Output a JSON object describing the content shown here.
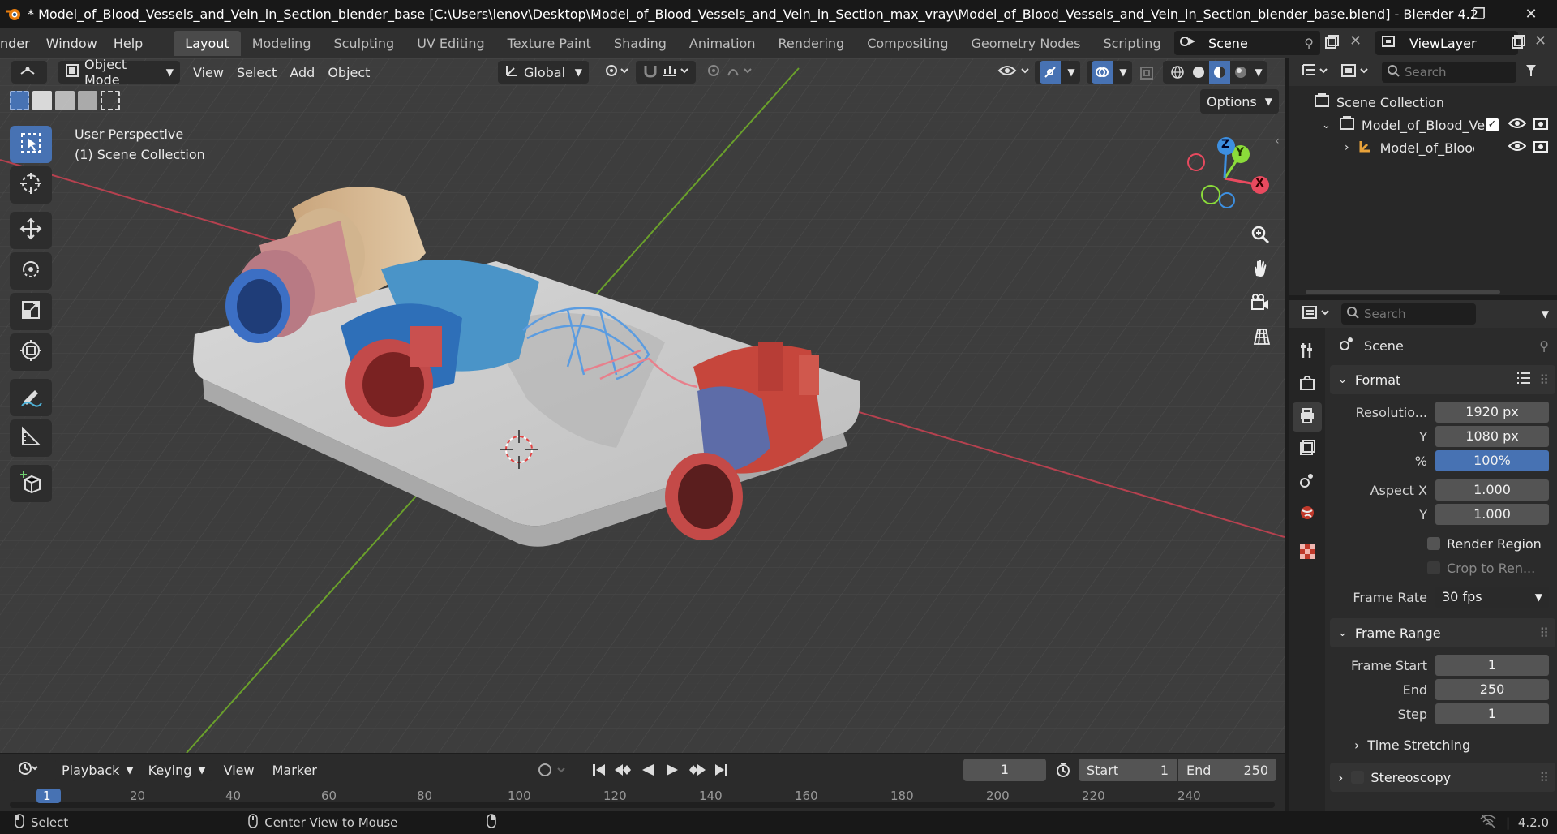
{
  "window": {
    "title": "* Model_of_Blood_Vessels_and_Vein_in_Section_blender_base [C:\\Users\\lenov\\Desktop\\Model_of_Blood_Vessels_and_Vein_in_Section_max_vray\\Model_of_Blood_Vessels_and_Vein_in_Section_blender_base.blend] - Blender 4.2",
    "minimize": "—",
    "restore": "❐",
    "close": "✕"
  },
  "menu": {
    "items": [
      "nder",
      "Window",
      "Help"
    ],
    "workspaces": [
      "Layout",
      "Modeling",
      "Sculpting",
      "UV Editing",
      "Texture Paint",
      "Shading",
      "Animation",
      "Rendering",
      "Compositing",
      "Geometry Nodes",
      "Scripting"
    ],
    "add_workspace": "+",
    "scene": "Scene",
    "view_layer": "ViewLayer"
  },
  "viewport": {
    "mode": "Object Mode",
    "menus": [
      "View",
      "Select",
      "Add",
      "Object"
    ],
    "transform_orientation": "Global",
    "options": "Options",
    "perspective_label": "User Perspective",
    "collection_label": "(1) Scene Collection"
  },
  "gizmo": {
    "x": "X",
    "y": "Y",
    "z": "Z"
  },
  "outliner": {
    "search_placeholder": "Search",
    "root": "Scene Collection",
    "items": [
      {
        "label": "Model_of_Blood_Ve"
      },
      {
        "label": "Model_of_Blood"
      }
    ]
  },
  "properties": {
    "search_placeholder": "Search",
    "context": "Scene",
    "format_panel": "Format",
    "resolution_x_label": "Resolutio...",
    "resolution_x": "1920 px",
    "resolution_y_label": "Y",
    "resolution_y": "1080 px",
    "percent_label": "%",
    "percent": "100%",
    "aspect_x_label": "Aspect X",
    "aspect_x": "1.000",
    "aspect_y_label": "Y",
    "aspect_y": "1.000",
    "render_region": "Render Region",
    "crop": "Crop to Ren...",
    "frame_rate_label": "Frame Rate",
    "frame_rate": "30 fps",
    "frame_range_panel": "Frame Range",
    "frame_start_label": "Frame Start",
    "frame_start": "1",
    "end_label": "End",
    "end": "250",
    "step_label": "Step",
    "step": "1",
    "time_stretching": "Time Stretching",
    "stereoscopy": "Stereoscopy"
  },
  "timeline": {
    "menus": [
      "Playback",
      "Keying",
      "View",
      "Marker"
    ],
    "current_frame": "1",
    "start_label": "Start",
    "start": "1",
    "end_label": "End",
    "end": "250",
    "ticks": [
      "1",
      "20",
      "40",
      "60",
      "80",
      "100",
      "120",
      "140",
      "160",
      "180",
      "200",
      "220",
      "240"
    ]
  },
  "status": {
    "select": "Select",
    "center_view": "Center View to Mouse",
    "version": "4.2.0"
  },
  "colors": {
    "accent": "#4772b3",
    "axis_x": "#e84a5f",
    "axis_y": "#8bdc3a",
    "axis_z": "#3d8fe0"
  }
}
